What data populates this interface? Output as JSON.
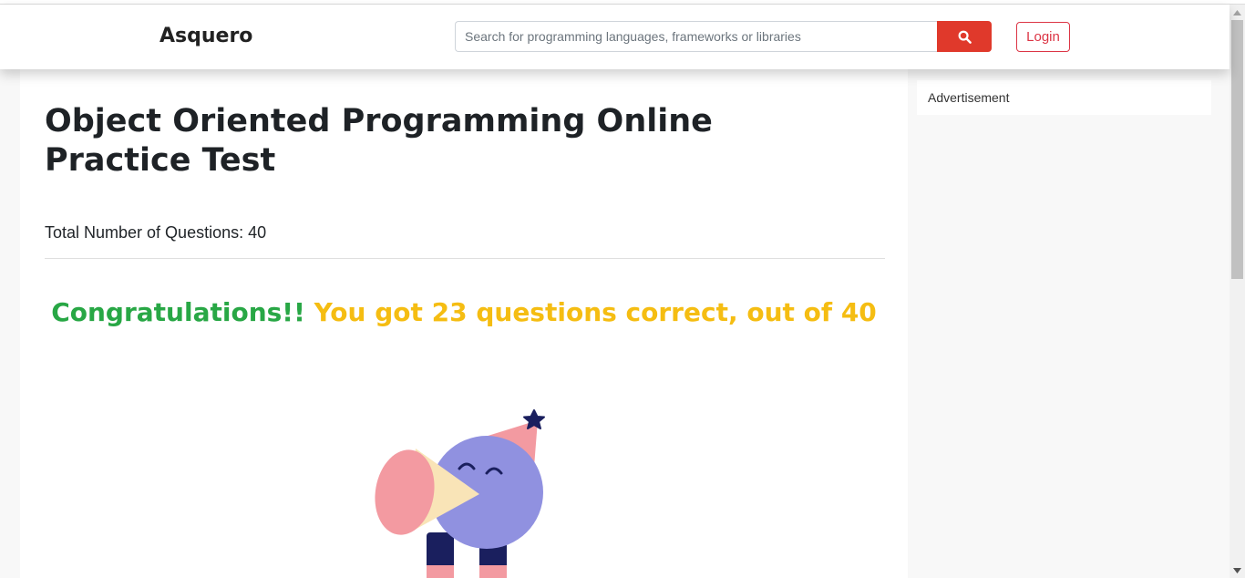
{
  "header": {
    "brand": "Asquero",
    "search_placeholder": "Search for programming languages, frameworks or libraries",
    "search_icon": "search-icon",
    "login_label": "Login"
  },
  "main": {
    "title": "Object Oriented Programming Online Practice Test",
    "total_questions": "Total Number of Questions: 40",
    "congrats": "Congratulations!!",
    "score_text": "You got 23 questions correct, out of 40"
  },
  "sidebar": {
    "ad_label": "Advertisement"
  },
  "colors": {
    "search_button": "#e0392b",
    "login_accent": "#dc3545",
    "congrats": "#28a745",
    "score": "#f5bd12"
  }
}
